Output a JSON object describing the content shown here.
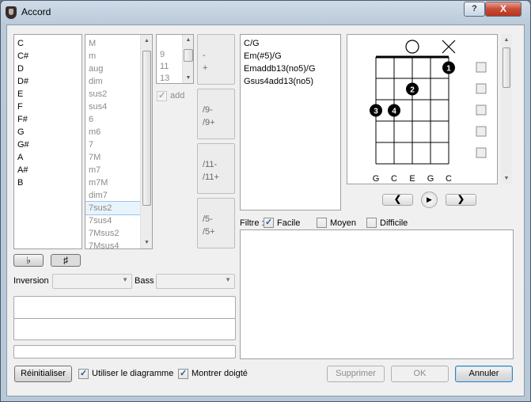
{
  "window": {
    "title": "Accord",
    "help_label": "?",
    "close_label": "X"
  },
  "roots": [
    "C",
    "C#",
    "D",
    "D#",
    "E",
    "F",
    "F#",
    "G",
    "G#",
    "A",
    "A#",
    "B"
  ],
  "qualities": [
    "M",
    "m",
    "aug",
    "dim",
    "sus2",
    "sus4",
    "6",
    "m6",
    "7",
    "7M",
    "m7",
    "m7M",
    "dim7",
    "7sus2",
    "7sus4",
    "7Msus2",
    "7Msus4"
  ],
  "qualities_selected": "7sus2",
  "extensions_num": [
    "9",
    "11",
    "13"
  ],
  "add_label": "add",
  "alter_buttons": [
    {
      "a": "-",
      "b": "+"
    },
    {
      "a": "/9-",
      "b": "/9+"
    },
    {
      "a": "/11-",
      "b": "/11+"
    },
    {
      "a": "/5-",
      "b": "/5+"
    }
  ],
  "accidentals": {
    "flat": "♭",
    "sharp": "♯"
  },
  "inversion_label": "Inversion",
  "bass_label": "Bass",
  "chord_names": [
    "C/G",
    "Em(#5)/G",
    "Emaddb13(no5)/G",
    "Gsus4add13(no5)"
  ],
  "diagram": {
    "strings": [
      "G",
      "C",
      "E",
      "G",
      "C"
    ],
    "string_markers": [
      "",
      "",
      "open",
      "",
      "mute"
    ],
    "fingers": [
      {
        "string": 4,
        "fret": 1,
        "finger": "1"
      },
      {
        "string": 2,
        "fret": 2,
        "finger": "2"
      },
      {
        "string": 0,
        "fret": 3,
        "finger": "3"
      },
      {
        "string": 1,
        "fret": 3,
        "finger": "4"
      }
    ],
    "fret_checkboxes": 5
  },
  "nav": {
    "prev": "❮",
    "play": "▶",
    "next": "❯"
  },
  "filter": {
    "label": "Filtre :",
    "options": [
      {
        "label": "Facile",
        "checked": true
      },
      {
        "label": "Moyen",
        "checked": false
      },
      {
        "label": "Difficile",
        "checked": false
      }
    ]
  },
  "buttons": {
    "reset": "Réinitialiser",
    "use_diagram": "Utiliser le diagramme",
    "show_fingering": "Montrer doigté",
    "delete": "Supprimer",
    "ok": "OK",
    "cancel": "Annuler"
  }
}
